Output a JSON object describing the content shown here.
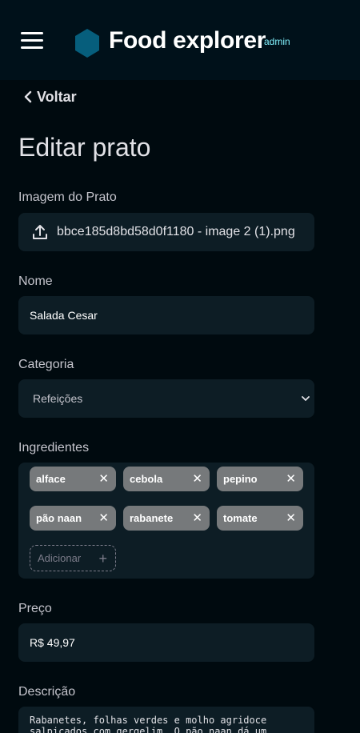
{
  "header": {
    "title": "Food explorer",
    "badge": "admin",
    "logo_color": "#065e7c"
  },
  "nav": {
    "back_label": "Voltar"
  },
  "page": {
    "title": "Editar prato"
  },
  "form": {
    "image": {
      "label": "Imagem do Prato",
      "filename": "bbce185d8bd58d0f1180 - image 2 (1).png"
    },
    "name": {
      "label": "Nome",
      "value": "Salada Cesar"
    },
    "category": {
      "label": "Categoria",
      "value": "Refeições"
    },
    "ingredients": {
      "label": "Ingredientes",
      "items": [
        "alface",
        "cebola",
        "pepino",
        "pão naan",
        "rabanete",
        "tomate"
      ],
      "add_placeholder": "Adicionar"
    },
    "price": {
      "label": "Preço",
      "value": "R$ 49,97"
    },
    "description": {
      "label": "Descrição",
      "value": "Rabanetes, folhas verdes e molho agridoce salpicados com gergelim. O pão naan dá um"
    }
  },
  "colors": {
    "background": "#000a0f",
    "header_bg": "#00111a",
    "field_bg": "#0d1d25",
    "tag_bg": "#76797b",
    "accent": "#82f3ff"
  }
}
